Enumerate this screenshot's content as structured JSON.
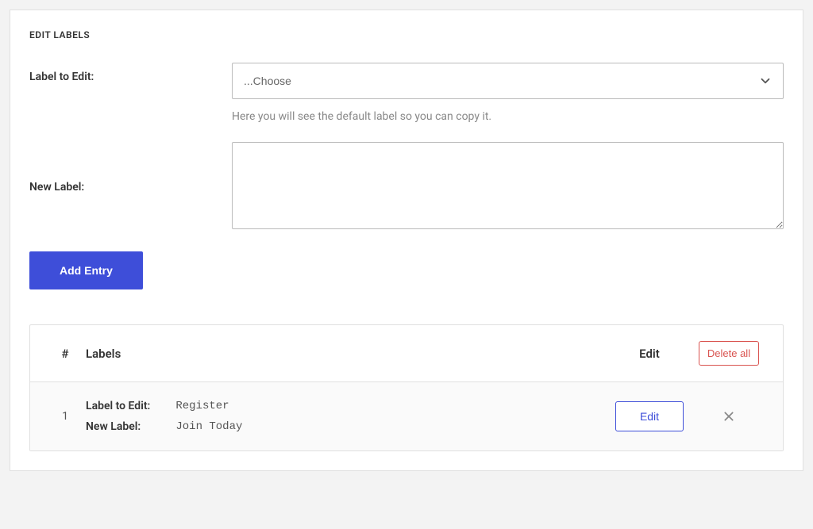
{
  "panel": {
    "title": "EDIT LABELS"
  },
  "form": {
    "label_to_edit": {
      "label": "Label to Edit:",
      "selected": "...Choose",
      "help": "Here you will see the default label so you can copy it."
    },
    "new_label": {
      "label": "New Label:",
      "value": ""
    },
    "add_entry_button": "Add Entry"
  },
  "table": {
    "headers": {
      "number": "#",
      "labels": "Labels",
      "edit": "Edit",
      "delete_all": "Delete all"
    },
    "row_keys": {
      "label_to_edit": "Label to Edit:",
      "new_label": "New Label:"
    },
    "rows": [
      {
        "number": "1",
        "label_to_edit_value": "Register",
        "new_label_value": "Join Today",
        "edit_button": "Edit"
      }
    ]
  }
}
